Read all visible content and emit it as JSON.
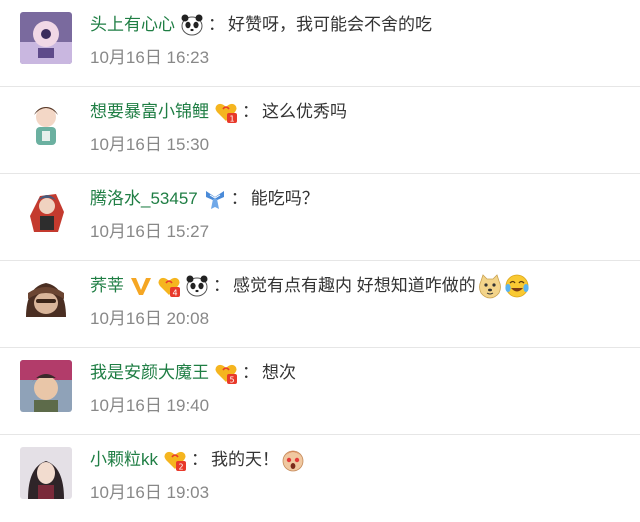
{
  "comments": [
    {
      "username": "头上有心心",
      "badges": [
        "panda-icon"
      ],
      "text": "好赞呀，我可能会不舍的吃",
      "emojis": [],
      "timestamp": "10月16日 16:23"
    },
    {
      "username": "想要暴富小锦鲤",
      "badges": [
        "fan-level-1-icon"
      ],
      "text": "这么优秀吗",
      "emojis": [],
      "timestamp": "10月16日 15:30"
    },
    {
      "username": "腾洛水_53457",
      "badges": [
        "tie-badge-icon"
      ],
      "text": "能吃吗？",
      "emojis": [],
      "timestamp": "10月16日 15:27"
    },
    {
      "username": "荞莘",
      "badges": [
        "verified-v-icon",
        "fan-level-4-icon",
        "panda-icon"
      ],
      "text": "感觉有点有趣内 好想知道咋做的",
      "emojis": [
        "doge-emoji-icon",
        "laugh-cry-emoji-icon"
      ],
      "timestamp": "10月16日 20:08"
    },
    {
      "username": "我是安颜大魔王",
      "badges": [
        "fan-level-5-icon"
      ],
      "text": "想次",
      "emojis": [],
      "timestamp": "10月16日 19:40"
    },
    {
      "username": "小颗粒kk",
      "badges": [
        "fan-level-2-icon"
      ],
      "text": "我的天！",
      "emojis": [
        "shocked-emoji-icon"
      ],
      "timestamp": "10月16日 19:03"
    }
  ],
  "punctuation": {
    "separator": "："
  },
  "fan_level_numbers": {
    "fan-level-1-icon": "1",
    "fan-level-2-icon": "2",
    "fan-level-4-icon": "4",
    "fan-level-5-icon": "5"
  },
  "colors": {
    "username": "#1f7e44",
    "text": "#333333",
    "timestamp": "#888888",
    "divider": "#e6e6e6",
    "fan_badge_gold": "#f5b51f",
    "fan_badge_red": "#e8392a",
    "verified_v": "#f5a623"
  }
}
